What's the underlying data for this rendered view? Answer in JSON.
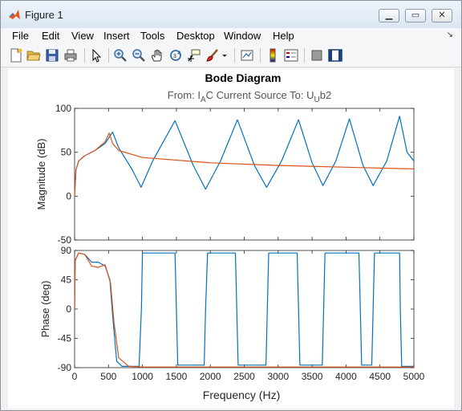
{
  "window": {
    "title": "Figure 1"
  },
  "menu": [
    "File",
    "Edit",
    "View",
    "Insert",
    "Tools",
    "Desktop",
    "Window",
    "Help"
  ],
  "toolbar_icons": [
    "new-figure-icon",
    "open-file-icon",
    "save-icon",
    "print-icon",
    "pointer-icon",
    "zoom-in-icon",
    "zoom-out-icon",
    "pan-hand-icon",
    "rotate-3d-icon",
    "data-cursor-icon",
    "brush-icon",
    "brush-dropdown-icon",
    "link-plot-icon",
    "colorbar-icon",
    "legend-icon",
    "hide-plot-tools-icon",
    "show-plot-tools-icon"
  ],
  "figure": {
    "title": "Bode Diagram",
    "subtitle": {
      "pre": "From: I",
      "sub1": "A",
      "mid": "C Current Source  To: U",
      "sub2": "U",
      "post": "b2"
    },
    "xlabel": "Frequency  (Hz)"
  },
  "chart_data": [
    {
      "type": "line",
      "ylabel": "Magnitude (dB)",
      "xlim": [
        0,
        5000
      ],
      "ylim": [
        -50,
        100
      ],
      "yticks": [
        "100",
        "50",
        "0",
        "-50"
      ],
      "series": [
        {
          "color": "#0072bd",
          "x": [
            0,
            20,
            60,
            150,
            300,
            450,
            560,
            650,
            850,
            980,
            1150,
            1480,
            1750,
            1930,
            2150,
            2400,
            2650,
            2830,
            3050,
            3300,
            3500,
            3660,
            3850,
            4050,
            4250,
            4400,
            4600,
            4790,
            4900,
            5000
          ],
          "y": [
            0,
            30,
            40,
            46,
            52,
            60,
            73,
            55,
            30,
            10,
            40,
            86,
            35,
            8,
            40,
            87,
            35,
            10,
            40,
            87,
            38,
            12,
            40,
            88,
            35,
            12,
            40,
            91,
            50,
            40
          ]
        },
        {
          "color": "#d95319",
          "x": [
            0,
            20,
            60,
            150,
            300,
            450,
            510,
            560,
            650,
            1000,
            2000,
            3000,
            4000,
            5000
          ],
          "y": [
            0,
            30,
            40,
            46,
            52,
            62,
            72,
            60,
            52,
            44,
            38,
            35,
            33,
            31
          ]
        }
      ]
    },
    {
      "type": "line",
      "ylabel": "Phase (deg)",
      "xlim": [
        0,
        5000
      ],
      "ylim": [
        -90,
        90
      ],
      "yticks": [
        "90",
        "45",
        "0",
        "-45",
        "-90"
      ],
      "xticks": [
        "0",
        "500",
        "1000",
        "1500",
        "2000",
        "2500",
        "3000",
        "3500",
        "4000",
        "4500",
        "5000"
      ],
      "series": [
        {
          "color": "#0072bd",
          "x": [
            0,
            10,
            60,
            150,
            250,
            350,
            450,
            520,
            560,
            620,
            700,
            950,
            985,
            1000,
            1480,
            1500,
            1520,
            1910,
            1930,
            1960,
            2370,
            2390,
            2410,
            2820,
            2840,
            2860,
            3280,
            3300,
            3320,
            3650,
            3670,
            3690,
            4190,
            4210,
            4230,
            4380,
            4400,
            4420,
            4790,
            4800,
            4820,
            5000
          ],
          "y": [
            0,
            75,
            86,
            84,
            72,
            72,
            66,
            45,
            -10,
            -80,
            -88,
            -88,
            0,
            86,
            86,
            0,
            -86,
            -86,
            0,
            86,
            86,
            0,
            -86,
            -86,
            0,
            86,
            86,
            0,
            -86,
            -86,
            0,
            86,
            86,
            0,
            -86,
            -86,
            0,
            86,
            86,
            0,
            -88,
            -88
          ]
        },
        {
          "color": "#d95319",
          "x": [
            0,
            10,
            60,
            150,
            250,
            350,
            450,
            530,
            580,
            650,
            800,
            1000,
            2000,
            5000
          ],
          "y": [
            0,
            75,
            86,
            84,
            66,
            64,
            68,
            40,
            -20,
            -75,
            -88,
            -89,
            -89,
            -89
          ]
        }
      ]
    }
  ]
}
